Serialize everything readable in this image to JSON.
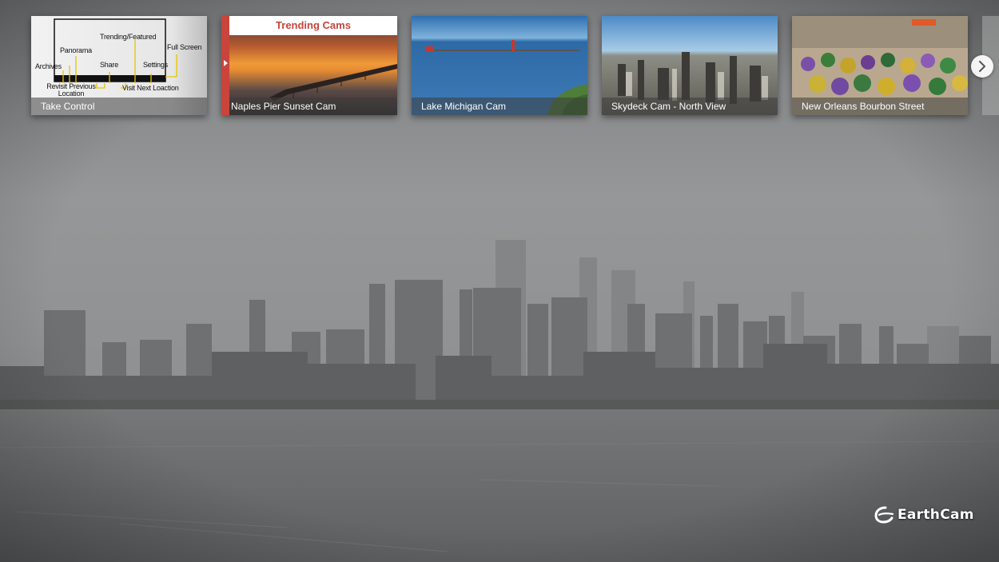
{
  "colors": {
    "trending_accent": "#c9443b",
    "sky_fog": "#8f9192",
    "water": "#6d6f70"
  },
  "carousel": {
    "cards": [
      {
        "caption": "Take Control",
        "diagram_labels": {
          "trending": "Trending/Featured",
          "panorama": "Panorama",
          "full_screen": "Full Screen",
          "archives": "Archives",
          "share": "Share",
          "settings": "Settings",
          "revisit": "Revisit Previous Location",
          "visit_next": "Visit Next Loaction"
        }
      },
      {
        "header": "Trending Cams",
        "caption": "Naples Pier Sunset Cam"
      },
      {
        "caption": "Lake Michigan Cam"
      },
      {
        "caption": "Skydeck Cam - North View"
      },
      {
        "caption": "New Orleans Bourbon Street"
      }
    ],
    "next_icon": "chevron-right-icon"
  },
  "logo": {
    "text": "EarthCam",
    "icon": "earthcam-globe-icon"
  }
}
